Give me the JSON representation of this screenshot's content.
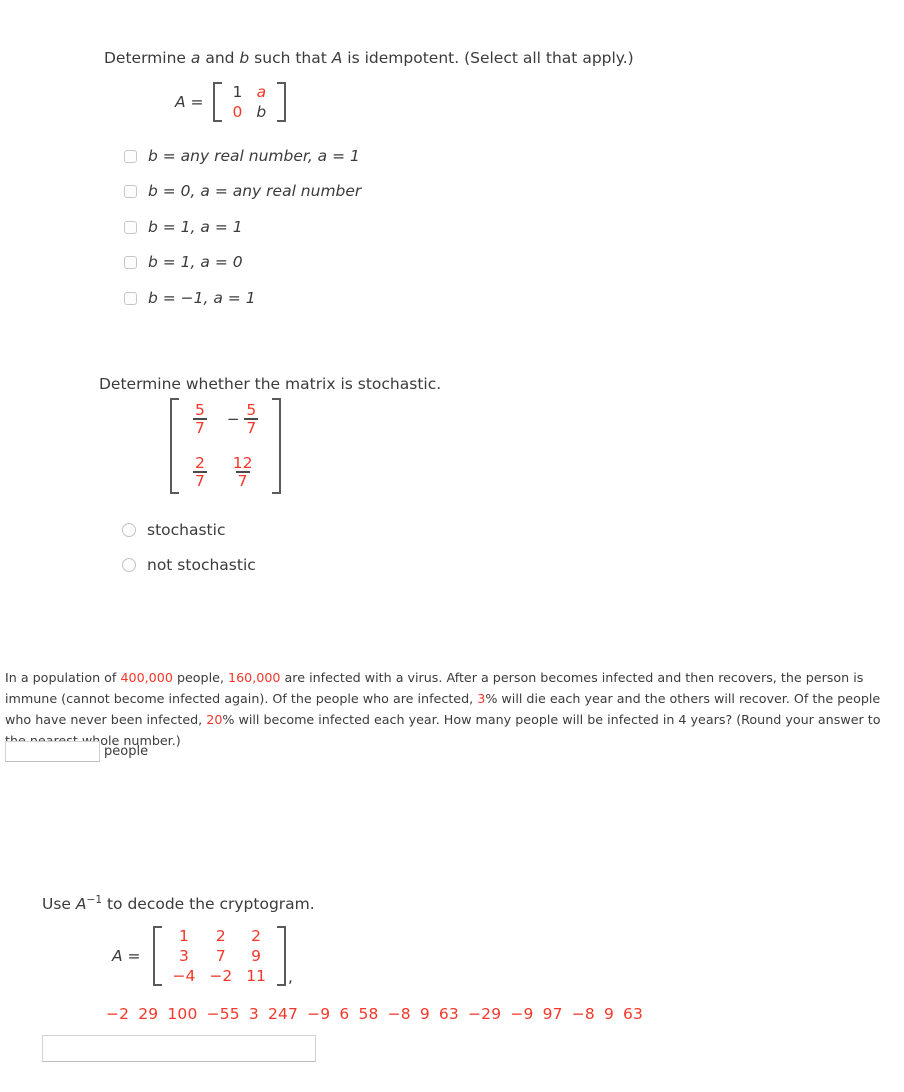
{
  "colors": {
    "text": "#3b3b3b",
    "accent_red": "#f4372a",
    "bracket": "#5a5a5a",
    "input_border": "#d2d2d2"
  },
  "q1": {
    "prompt_part1": "Determine ",
    "prompt_a": "a",
    "prompt_and": " and ",
    "prompt_b": "b",
    "prompt_part2": " such that ",
    "prompt_A": "A",
    "prompt_part3": " is idempotent. (Select all that apply.)",
    "matrix_label": "A =",
    "matrix": {
      "rows": [
        [
          {
            "text": "1",
            "color": "dark"
          },
          {
            "text": "a",
            "color": "red",
            "italic": true
          }
        ],
        [
          {
            "text": "0",
            "color": "red"
          },
          {
            "text": "b",
            "color": "dark",
            "italic": true
          }
        ]
      ]
    },
    "options": [
      "b = any real number, a = 1",
      "b = 0, a = any real number",
      "b = 1, a = 1",
      "b = 1, a = 0",
      "b = −1, a = 1"
    ]
  },
  "q2": {
    "prompt": "Determine whether the matrix is stochastic.",
    "matrix": {
      "rows": [
        [
          {
            "num": "5",
            "den": "7",
            "sign": ""
          },
          {
            "num": "5",
            "den": "7",
            "sign": "−"
          }
        ],
        [
          {
            "num": "2",
            "den": "7",
            "sign": ""
          },
          {
            "num": "12",
            "den": "7",
            "sign": ""
          }
        ]
      ]
    },
    "options": [
      "stochastic",
      "not stochastic"
    ]
  },
  "q3": {
    "text_1": "In a population of ",
    "val_population": "400,000",
    "text_2": " people, ",
    "val_infected": "160,000",
    "text_3": " are infected with a virus. After a person becomes infected and then recovers, the person is immune (cannot become infected again). Of the people who are infected, ",
    "val_death_rate": "3",
    "text_4": "% will die each year and the others will recover. Of the people who have never been infected, ",
    "val_infect_rate": "20",
    "text_5": "% will become infected each year. How many people will be infected in 4 years? (Round your answer to the nearest whole number.)",
    "answer_value": "",
    "answer_unit": "people"
  },
  "q4": {
    "prompt_pre": "Use ",
    "prompt_A": "A",
    "prompt_exp": "−1",
    "prompt_post": " to decode the cryptogram.",
    "matrix_label": "A =",
    "matrix": {
      "rows": [
        [
          "1",
          "2",
          "2"
        ],
        [
          "3",
          "7",
          "9"
        ],
        [
          "−4",
          "−2",
          "11"
        ]
      ]
    },
    "matrix_trailing": ",",
    "cryptogram": [
      "−2",
      "29",
      "100",
      "−55",
      "3",
      "247",
      "−9",
      "6",
      "58",
      "−8",
      "9",
      "63",
      "−29",
      "−9",
      "97",
      "−8",
      "9",
      "63"
    ],
    "answer_value": ""
  }
}
